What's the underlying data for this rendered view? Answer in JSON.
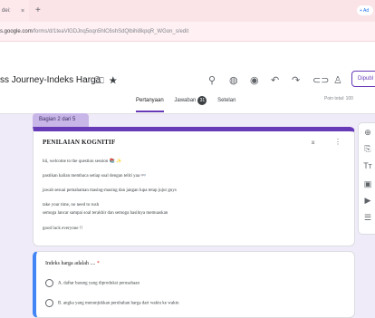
{
  "browser": {
    "tab_title": "dei:",
    "tab_close": "×",
    "new_tab": "+",
    "right_btn": "+ Ad",
    "url_host": "s.google.com",
    "url_path": "/forms/d/1teaVlGDJnq5oqn5hlC6shSdQlbihi8kpqR_WGon_s/edit"
  },
  "header": {
    "doc_title": "ss Journey-Indeks Harga",
    "publish_label": "Dipubl",
    "tabs": [
      {
        "label": "Pertanyaan"
      },
      {
        "label": "Jawaban"
      },
      {
        "label": "Setelan"
      }
    ],
    "responses_count": "31",
    "total_points": "Poin total: 100"
  },
  "section": {
    "tab_label": "Bagian 2 dari 5",
    "title": "PENILAIAN KOGNITIF",
    "description": [
      "hii, welcome to the question session 📚 ✨",
      "pastikan kalian membaca setiap soal dengan teliti yaa 👓",
      "jawab sesuai pemahaman masing-masing dan jangan lupa tetap jujur guys",
      "take your time, no need to rush",
      "semoga lancar sampai soal terakhir dan semoga hasilnya memuaskan",
      "good luck everyone !!"
    ]
  },
  "question": {
    "title": "Indeks harga adalah .... ",
    "required_mark": "*",
    "options": [
      "A. daftar barang yang diproduksi perusahaan",
      "B. angka yang menunjukkan perubahan harga dari waktu ke waktu"
    ]
  },
  "icons": {
    "accent": "#673ab7",
    "sidebar": [
      "add-question-icon",
      "import-question-icon",
      "add-title-icon",
      "add-image-icon",
      "add-video-icon",
      "add-section-icon"
    ]
  }
}
